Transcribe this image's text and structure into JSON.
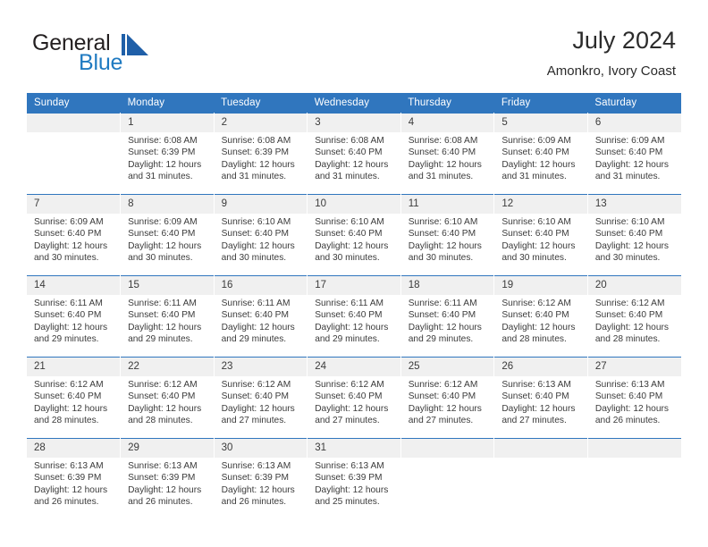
{
  "brand": {
    "line1": "General",
    "line2": "Blue",
    "mark_name": "blue-triangle-logo-mark",
    "color_dark": "#231f20",
    "color_blue": "#1f7ac1"
  },
  "header": {
    "title": "July 2024",
    "subtitle": "Amonkro, Ivory Coast"
  },
  "theme": {
    "header_bg": "#3076BE",
    "daynum_bg": "#f0f0f0",
    "text": "#3b3b3b"
  },
  "calendar": {
    "weekday_headers": [
      "Sunday",
      "Monday",
      "Tuesday",
      "Wednesday",
      "Thursday",
      "Friday",
      "Saturday"
    ],
    "weeks": [
      [
        {
          "day": "",
          "sunrise": "",
          "sunset": "",
          "daylight": "",
          "daylight2": ""
        },
        {
          "day": "1",
          "sunrise": "Sunrise: 6:08 AM",
          "sunset": "Sunset: 6:39 PM",
          "daylight": "Daylight: 12 hours",
          "daylight2": "and 31 minutes."
        },
        {
          "day": "2",
          "sunrise": "Sunrise: 6:08 AM",
          "sunset": "Sunset: 6:39 PM",
          "daylight": "Daylight: 12 hours",
          "daylight2": "and 31 minutes."
        },
        {
          "day": "3",
          "sunrise": "Sunrise: 6:08 AM",
          "sunset": "Sunset: 6:40 PM",
          "daylight": "Daylight: 12 hours",
          "daylight2": "and 31 minutes."
        },
        {
          "day": "4",
          "sunrise": "Sunrise: 6:08 AM",
          "sunset": "Sunset: 6:40 PM",
          "daylight": "Daylight: 12 hours",
          "daylight2": "and 31 minutes."
        },
        {
          "day": "5",
          "sunrise": "Sunrise: 6:09 AM",
          "sunset": "Sunset: 6:40 PM",
          "daylight": "Daylight: 12 hours",
          "daylight2": "and 31 minutes."
        },
        {
          "day": "6",
          "sunrise": "Sunrise: 6:09 AM",
          "sunset": "Sunset: 6:40 PM",
          "daylight": "Daylight: 12 hours",
          "daylight2": "and 31 minutes."
        }
      ],
      [
        {
          "day": "7",
          "sunrise": "Sunrise: 6:09 AM",
          "sunset": "Sunset: 6:40 PM",
          "daylight": "Daylight: 12 hours",
          "daylight2": "and 30 minutes."
        },
        {
          "day": "8",
          "sunrise": "Sunrise: 6:09 AM",
          "sunset": "Sunset: 6:40 PM",
          "daylight": "Daylight: 12 hours",
          "daylight2": "and 30 minutes."
        },
        {
          "day": "9",
          "sunrise": "Sunrise: 6:10 AM",
          "sunset": "Sunset: 6:40 PM",
          "daylight": "Daylight: 12 hours",
          "daylight2": "and 30 minutes."
        },
        {
          "day": "10",
          "sunrise": "Sunrise: 6:10 AM",
          "sunset": "Sunset: 6:40 PM",
          "daylight": "Daylight: 12 hours",
          "daylight2": "and 30 minutes."
        },
        {
          "day": "11",
          "sunrise": "Sunrise: 6:10 AM",
          "sunset": "Sunset: 6:40 PM",
          "daylight": "Daylight: 12 hours",
          "daylight2": "and 30 minutes."
        },
        {
          "day": "12",
          "sunrise": "Sunrise: 6:10 AM",
          "sunset": "Sunset: 6:40 PM",
          "daylight": "Daylight: 12 hours",
          "daylight2": "and 30 minutes."
        },
        {
          "day": "13",
          "sunrise": "Sunrise: 6:10 AM",
          "sunset": "Sunset: 6:40 PM",
          "daylight": "Daylight: 12 hours",
          "daylight2": "and 30 minutes."
        }
      ],
      [
        {
          "day": "14",
          "sunrise": "Sunrise: 6:11 AM",
          "sunset": "Sunset: 6:40 PM",
          "daylight": "Daylight: 12 hours",
          "daylight2": "and 29 minutes."
        },
        {
          "day": "15",
          "sunrise": "Sunrise: 6:11 AM",
          "sunset": "Sunset: 6:40 PM",
          "daylight": "Daylight: 12 hours",
          "daylight2": "and 29 minutes."
        },
        {
          "day": "16",
          "sunrise": "Sunrise: 6:11 AM",
          "sunset": "Sunset: 6:40 PM",
          "daylight": "Daylight: 12 hours",
          "daylight2": "and 29 minutes."
        },
        {
          "day": "17",
          "sunrise": "Sunrise: 6:11 AM",
          "sunset": "Sunset: 6:40 PM",
          "daylight": "Daylight: 12 hours",
          "daylight2": "and 29 minutes."
        },
        {
          "day": "18",
          "sunrise": "Sunrise: 6:11 AM",
          "sunset": "Sunset: 6:40 PM",
          "daylight": "Daylight: 12 hours",
          "daylight2": "and 29 minutes."
        },
        {
          "day": "19",
          "sunrise": "Sunrise: 6:12 AM",
          "sunset": "Sunset: 6:40 PM",
          "daylight": "Daylight: 12 hours",
          "daylight2": "and 28 minutes."
        },
        {
          "day": "20",
          "sunrise": "Sunrise: 6:12 AM",
          "sunset": "Sunset: 6:40 PM",
          "daylight": "Daylight: 12 hours",
          "daylight2": "and 28 minutes."
        }
      ],
      [
        {
          "day": "21",
          "sunrise": "Sunrise: 6:12 AM",
          "sunset": "Sunset: 6:40 PM",
          "daylight": "Daylight: 12 hours",
          "daylight2": "and 28 minutes."
        },
        {
          "day": "22",
          "sunrise": "Sunrise: 6:12 AM",
          "sunset": "Sunset: 6:40 PM",
          "daylight": "Daylight: 12 hours",
          "daylight2": "and 28 minutes."
        },
        {
          "day": "23",
          "sunrise": "Sunrise: 6:12 AM",
          "sunset": "Sunset: 6:40 PM",
          "daylight": "Daylight: 12 hours",
          "daylight2": "and 27 minutes."
        },
        {
          "day": "24",
          "sunrise": "Sunrise: 6:12 AM",
          "sunset": "Sunset: 6:40 PM",
          "daylight": "Daylight: 12 hours",
          "daylight2": "and 27 minutes."
        },
        {
          "day": "25",
          "sunrise": "Sunrise: 6:12 AM",
          "sunset": "Sunset: 6:40 PM",
          "daylight": "Daylight: 12 hours",
          "daylight2": "and 27 minutes."
        },
        {
          "day": "26",
          "sunrise": "Sunrise: 6:13 AM",
          "sunset": "Sunset: 6:40 PM",
          "daylight": "Daylight: 12 hours",
          "daylight2": "and 27 minutes."
        },
        {
          "day": "27",
          "sunrise": "Sunrise: 6:13 AM",
          "sunset": "Sunset: 6:40 PM",
          "daylight": "Daylight: 12 hours",
          "daylight2": "and 26 minutes."
        }
      ],
      [
        {
          "day": "28",
          "sunrise": "Sunrise: 6:13 AM",
          "sunset": "Sunset: 6:39 PM",
          "daylight": "Daylight: 12 hours",
          "daylight2": "and 26 minutes."
        },
        {
          "day": "29",
          "sunrise": "Sunrise: 6:13 AM",
          "sunset": "Sunset: 6:39 PM",
          "daylight": "Daylight: 12 hours",
          "daylight2": "and 26 minutes."
        },
        {
          "day": "30",
          "sunrise": "Sunrise: 6:13 AM",
          "sunset": "Sunset: 6:39 PM",
          "daylight": "Daylight: 12 hours",
          "daylight2": "and 26 minutes."
        },
        {
          "day": "31",
          "sunrise": "Sunrise: 6:13 AM",
          "sunset": "Sunset: 6:39 PM",
          "daylight": "Daylight: 12 hours",
          "daylight2": "and 25 minutes."
        },
        {
          "day": "",
          "sunrise": "",
          "sunset": "",
          "daylight": "",
          "daylight2": ""
        },
        {
          "day": "",
          "sunrise": "",
          "sunset": "",
          "daylight": "",
          "daylight2": ""
        },
        {
          "day": "",
          "sunrise": "",
          "sunset": "",
          "daylight": "",
          "daylight2": ""
        }
      ]
    ]
  }
}
